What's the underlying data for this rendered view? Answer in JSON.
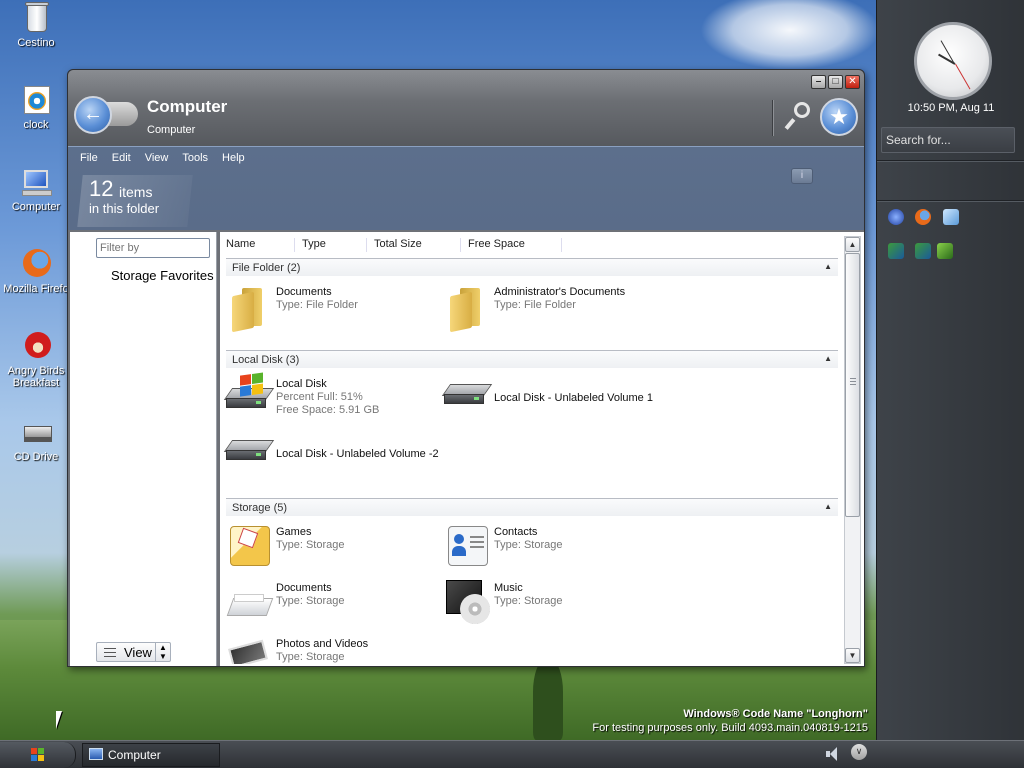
{
  "desktop": {
    "icons": [
      {
        "label": "Cestino",
        "icon": "recycle-bin-icon"
      },
      {
        "label": "clock",
        "icon": "media-player-icon"
      },
      {
        "label": "Computer",
        "icon": "computer-icon"
      },
      {
        "label": "Mozilla Firefo",
        "icon": "firefox-icon"
      },
      {
        "label": "Angry Birds Breakfast",
        "icon": "angry-birds-icon"
      },
      {
        "label": "CD Drive",
        "icon": "cd-drive-icon"
      }
    ],
    "watermark_line1": "Windows® Code Name \"Longhorn\"",
    "watermark_line2": "For testing purposes only. Build 4093.main.040819-1215"
  },
  "window": {
    "title": "Computer",
    "subtitle": "Computer",
    "controls": {
      "minimize": "–",
      "maximize": "□",
      "close": "✕"
    },
    "menu": [
      "File",
      "Edit",
      "View",
      "Tools",
      "Help"
    ],
    "item_count": "12",
    "item_unit": "items",
    "item_sub": "in this folder",
    "info_button": "i",
    "left_pane": {
      "filter_placeholder": "Filter by",
      "storage_favorites": "Storage Favorites",
      "view_label": "View"
    },
    "columns": [
      "Name",
      "Type",
      "Total Size",
      "Free Space"
    ],
    "groups": [
      {
        "header": "File Folder (2)",
        "items": [
          {
            "name": "Documents",
            "line2": "Type: File Folder",
            "icon": "folder-icon"
          },
          {
            "name": "Administrator's Documents",
            "line2": "Type: File Folder",
            "icon": "folder-icon"
          }
        ]
      },
      {
        "header": "Local Disk (3)",
        "items": [
          {
            "name": "Local Disk",
            "line2": "Percent Full: 51%",
            "line3": "Free Space: 5.91 GB",
            "icon": "system-drive-icon"
          },
          {
            "name": "Local Disk - Unlabeled Volume 1",
            "icon": "hard-drive-icon"
          },
          {
            "name": "Local Disk - Unlabeled Volume -2",
            "icon": "hard-drive-icon"
          }
        ]
      },
      {
        "header": "Storage (5)",
        "items": [
          {
            "name": "Games",
            "line2": "Type: Storage",
            "icon": "games-folder-icon"
          },
          {
            "name": "Contacts",
            "line2": "Type: Storage",
            "icon": "contacts-icon"
          },
          {
            "name": "Documents",
            "line2": "Type: Storage",
            "icon": "documents-storage-icon"
          },
          {
            "name": "Music",
            "line2": "Type: Storage",
            "icon": "music-icon"
          },
          {
            "name": "Photos and Videos",
            "line2": "Type: Storage",
            "icon": "photos-icon"
          }
        ]
      }
    ]
  },
  "sidebar": {
    "clock_text": "10:50 PM, Aug 11",
    "search_placeholder": "Search for..."
  },
  "taskbar": {
    "task_label": "Computer"
  },
  "colors": {
    "window_chrome": "#6e7177",
    "command_area": "#5c6f8c",
    "sidebar": "#3e4349",
    "taskbar": "#2e3136"
  }
}
